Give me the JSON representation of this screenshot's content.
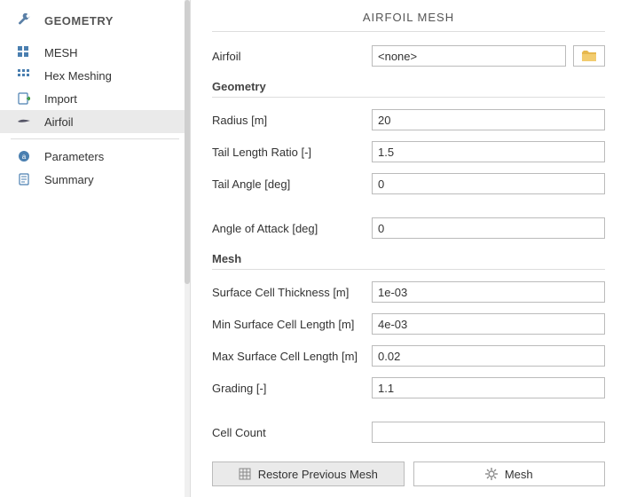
{
  "sidebar": {
    "header": "GEOMETRY",
    "items": [
      {
        "label": "MESH"
      },
      {
        "label": "Hex Meshing"
      },
      {
        "label": "Import"
      },
      {
        "label": "Airfoil"
      }
    ],
    "items2": [
      {
        "label": "Parameters"
      },
      {
        "label": "Summary"
      }
    ]
  },
  "main": {
    "title": "AIRFOIL MESH",
    "airfoil_label": "Airfoil",
    "airfoil_value": "<none>",
    "geometry_header": "Geometry",
    "radius_label": "Radius [m]",
    "radius_value": "20",
    "tail_length_label": "Tail Length Ratio [-]",
    "tail_length_value": "1.5",
    "tail_angle_label": "Tail Angle [deg]",
    "tail_angle_value": "0",
    "aoa_label": "Angle of Attack [deg]",
    "aoa_value": "0",
    "mesh_header": "Mesh",
    "surf_thick_label": "Surface Cell Thickness [m]",
    "surf_thick_value": "1e-03",
    "min_surf_label": "Min Surface Cell Length [m]",
    "min_surf_value": "4e-03",
    "max_surf_label": "Max Surface Cell Length [m]",
    "max_surf_value": "0.02",
    "grading_label": "Grading [-]",
    "grading_value": "1.1",
    "cell_count_label": "Cell Count",
    "cell_count_value": "",
    "restore_label": "Restore Previous Mesh",
    "mesh_button_label": "Mesh"
  }
}
